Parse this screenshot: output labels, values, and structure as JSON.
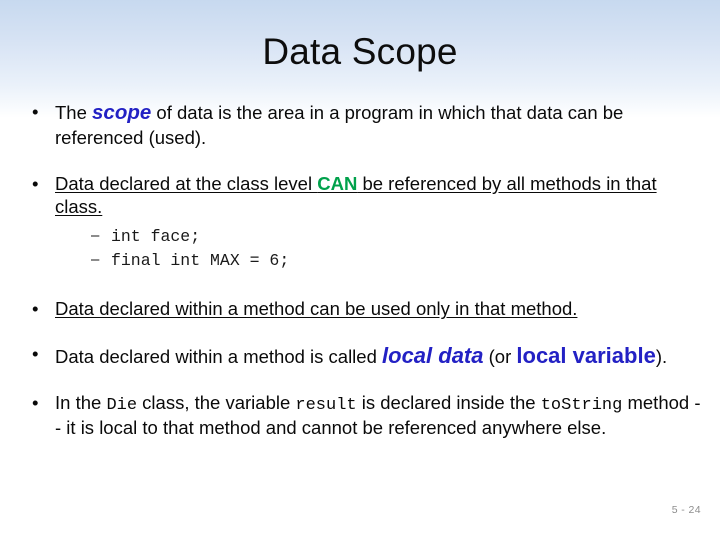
{
  "slide": {
    "title": "Data Scope",
    "bullet_marker": "•",
    "sub_marker": "–",
    "page_number": "5 - 24",
    "colors": {
      "accent_blue": "#2321c4",
      "accent_green": "#00a14b",
      "gradient_top": "#c7d9ef",
      "gradient_bottom": "#ffffff",
      "page_number_gray": "#8d8d8d"
    },
    "bullets": [
      {
        "id": "bullet-scope-definition",
        "underlined": false,
        "parts": [
          {
            "text": "The ",
            "style": "plain"
          },
          {
            "text": "scope",
            "style": "blue-bold-italic"
          },
          {
            "text": " of data is the area in a program in which that data can be referenced (used).",
            "style": "plain"
          }
        ]
      },
      {
        "id": "bullet-class-level",
        "underlined": true,
        "parts": [
          {
            "text": "Data declared at the class level ",
            "style": "plain"
          },
          {
            "text": "CAN",
            "style": "green-bold"
          },
          {
            "text": " be referenced by all methods in that class.",
            "style": "plain"
          }
        ],
        "sub_items": [
          {
            "id": "sub-int-face",
            "text": "int face;"
          },
          {
            "id": "sub-final-int-max",
            "text": "final int MAX = 6;"
          }
        ]
      },
      {
        "id": "bullet-method-scope",
        "underlined": true,
        "parts": [
          {
            "text": "Data declared within a method can be used only in that method.",
            "style": "plain"
          }
        ]
      },
      {
        "id": "bullet-local-data",
        "underlined": false,
        "parts": [
          {
            "text": "Data declared within a method is called ",
            "style": "plain"
          },
          {
            "text": "local data",
            "style": "blue-bold-italic-large"
          },
          {
            "text": " (or ",
            "style": "plain"
          },
          {
            "text": "local variable",
            "style": "blue-bold-large"
          },
          {
            "text": ").",
            "style": "plain"
          }
        ]
      },
      {
        "id": "bullet-die-example",
        "underlined": false,
        "parts": [
          {
            "text": "In the ",
            "style": "plain"
          },
          {
            "text": "Die",
            "style": "code"
          },
          {
            "text": " class, the variable ",
            "style": "plain"
          },
          {
            "text": "result",
            "style": "code"
          },
          {
            "text": " is declared inside the ",
            "style": "plain"
          },
          {
            "text": "toString",
            "style": "code"
          },
          {
            "text": " method -- it is local to that method and cannot be referenced anywhere else.",
            "style": "plain"
          }
        ]
      }
    ]
  }
}
